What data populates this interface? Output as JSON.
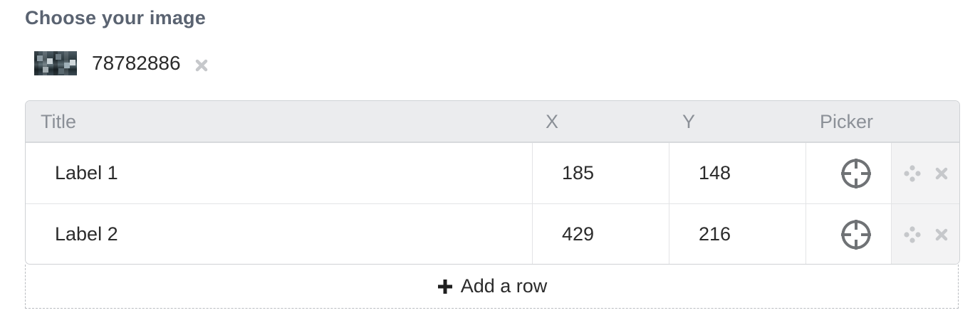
{
  "heading": "Choose your image",
  "image": {
    "id": "78782886",
    "thumbnail_icon": "image-thumbnail",
    "remove_icon": "close-icon"
  },
  "table": {
    "columns": [
      "Title",
      "X",
      "Y",
      "Picker"
    ],
    "rows": [
      {
        "title": "Label 1",
        "x": "185",
        "y": "148",
        "picker_icon": "crosshair-icon"
      },
      {
        "title": "Label 2",
        "x": "429",
        "y": "216",
        "picker_icon": "crosshair-icon"
      }
    ],
    "row_actions": [
      "drag-handle-icon",
      "close-icon"
    ]
  },
  "add_row_label": "Add a row",
  "colors": {
    "heading": "#5a6371",
    "header_bg": "#ebecee",
    "icon_gray": "#c6c8cb",
    "picker_gray": "#6f7275"
  }
}
